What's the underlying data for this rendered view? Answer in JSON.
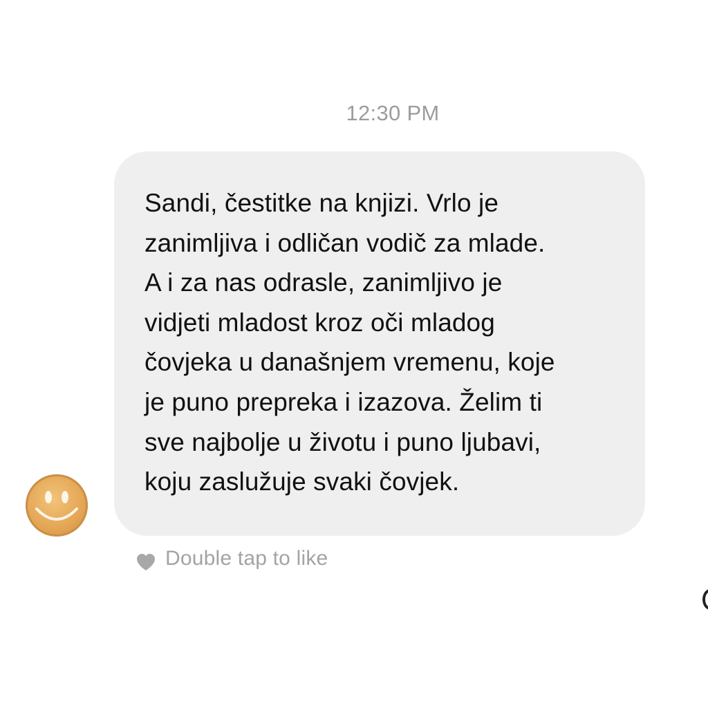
{
  "conversation": {
    "timestamp": "12:30 PM",
    "message": {
      "sender_avatar": "smiley-face-avatar",
      "text": "Sandi, čestitke na knjizi. Vrlo je\nzanimljiva i odličan vodič za mlade.\nA i za nas odrasle, zanimljivo je\nvidjeti mladost kroz oči mladog\nčovjeka u današnjem vremenu, koje\nje puno prepreka i izazova. Želim ti\nsve najbolje u životu i puno ljubavi,\nkoju zaslužuje svaki čovjek.",
      "bubble_color": "#efefef"
    },
    "like_hint": {
      "icon": "heart-icon",
      "label": "Double tap to like",
      "color": "#a3a3a3"
    }
  }
}
